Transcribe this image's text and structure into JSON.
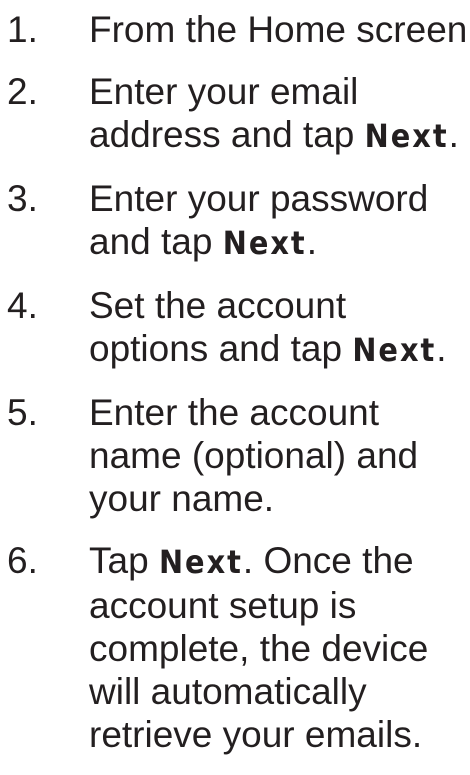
{
  "steps": [
    {
      "number": "1.",
      "line1": "From the Home screen"
    },
    {
      "number": "2.",
      "line1": "Enter your email",
      "line2_pre": "address and tap ",
      "line2_kw": "Next",
      "line2_post": "."
    },
    {
      "number": "3.",
      "line1": "Enter your password",
      "line2_pre": "and tap ",
      "line2_kw": "Next",
      "line2_post": "."
    },
    {
      "number": "4.",
      "line1": "Set the account",
      "line2_pre": "options and tap ",
      "line2_kw": "Next",
      "line2_post": "."
    },
    {
      "number": "5.",
      "line1": "Enter the account",
      "line2": "name (optional) and",
      "line3": "your name."
    },
    {
      "number": "6.",
      "line1_pre": "Tap ",
      "line1_kw": "Next",
      "line1_post": ". Once the",
      "line2": "account setup is",
      "line3": "complete, the device",
      "line4": "will automatically",
      "line5": "retrieve your emails."
    }
  ]
}
